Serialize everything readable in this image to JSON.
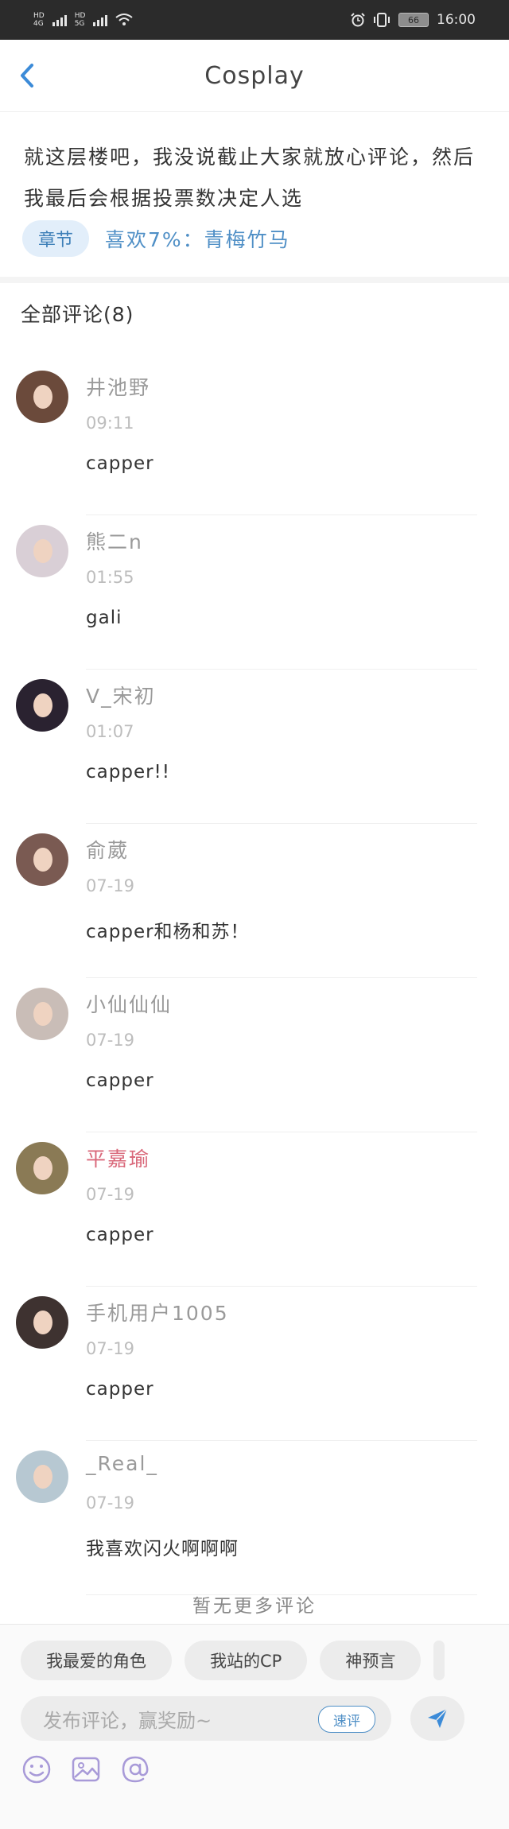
{
  "status_bar": {
    "sim1_labels": [
      "HD",
      "4G"
    ],
    "sim2_labels": [
      "HD",
      "5G"
    ],
    "battery": "66",
    "time": "16:00",
    "icons": [
      "signal-icon",
      "wifi-icon",
      "alarm-icon",
      "vibrate-icon",
      "battery-icon"
    ]
  },
  "header": {
    "title": "Cosplay",
    "back_icon": "chevron-left-icon"
  },
  "post": {
    "body": "就这层楼吧，我没说截止大家就放心评论，然后我最后会根据投票数决定人选",
    "chapter_tag": "章节",
    "like_text": "喜欢7%：青梅竹马"
  },
  "comments_header": "全部评论(8)",
  "comments": [
    {
      "user": "井池野",
      "time": "09:11",
      "content": "capper",
      "avatar_color": "#6b4a3b"
    },
    {
      "user": "熊二n",
      "time": "01:55",
      "content": "gali",
      "avatar_color": "#d9cfd6"
    },
    {
      "user": "V_宋初",
      "time": "01:07",
      "content": "capper!!",
      "avatar_color": "#2a2230"
    },
    {
      "user": "俞葳",
      "time": "07-19",
      "content": "capper和杨和苏！",
      "avatar_color": "#7a5a52"
    },
    {
      "user": "小仙仙仙",
      "time": "07-19",
      "content": "capper",
      "avatar_color": "#c9bdb7"
    },
    {
      "user": "平嘉瑜",
      "time": "07-19",
      "content": "capper",
      "avatar_color": "#8a7a55",
      "highlight": true
    },
    {
      "user": "手机用户1005",
      "time": "07-19",
      "content": "capper",
      "avatar_color": "#3e3230"
    },
    {
      "user": "_Real_",
      "time": "07-19",
      "content": "我喜欢闪火啊啊啊",
      "avatar_color": "#b7c8d2"
    }
  ],
  "end_text": "暂无更多评论",
  "input_bar": {
    "quick_chips": [
      "我最爱的角色",
      "我站的CP",
      "神预言"
    ],
    "placeholder": "发布评论，赢奖励~",
    "quick_review_label": "速评",
    "send_icon": "send-icon",
    "tool_icons": [
      "emoji-icon",
      "image-icon",
      "mention-icon"
    ],
    "accent": "#4f8fc6",
    "tool_color": "#a89ad8"
  }
}
